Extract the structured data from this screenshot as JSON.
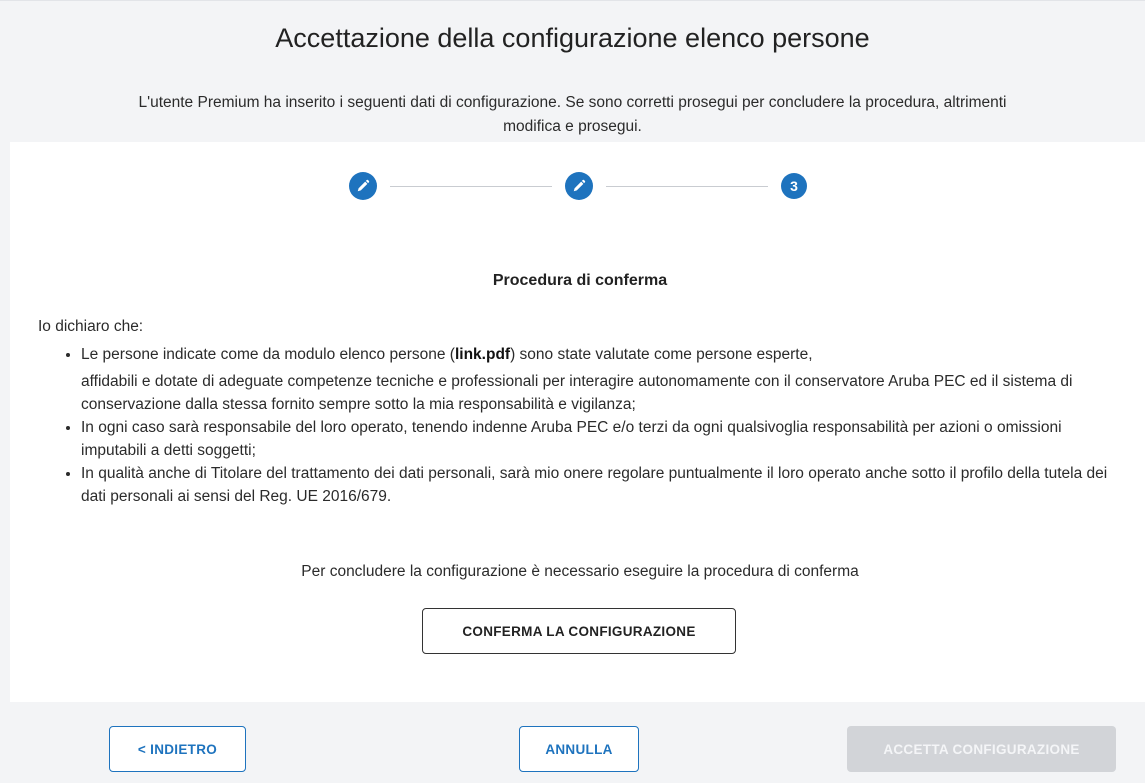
{
  "header": {
    "title": "Accettazione della configurazione elenco persone",
    "subtitle_line1": "L'utente Premium ha inserito i seguenti dati di configurazione. Se sono corretti prosegui per concludere la procedura, altrimenti",
    "subtitle_line2": "modifica e prosegui."
  },
  "stepper": {
    "steps": [
      {
        "state": "completed",
        "icon": "pencil-icon"
      },
      {
        "state": "completed",
        "icon": "pencil-icon"
      },
      {
        "state": "current",
        "label": "3"
      }
    ],
    "accent_color": "#1e73be"
  },
  "content": {
    "section_title": "Procedura di conferma",
    "declaration_intro": "Io dichiaro che:",
    "bullets": [
      {
        "prefix": "Le persone indicate come da modulo elenco persone (",
        "link": "link.pdf",
        "suffix_line1": ") sono state valutate come persone esperte,",
        "rest": "affidabili e dotate di adeguate competenze tecniche e professionali per interagire autonomamente con il conservatore Aruba PEC ed il sistema di conservazione dalla stessa fornito sempre sotto la mia responsabilità e vigilanza;"
      },
      {
        "text": "In ogni caso sarà responsabile del loro operato, tenendo indenne Aruba PEC e/o terzi da ogni qualsivoglia responsabilità per azioni o omissioni imputabili a detti soggetti;"
      },
      {
        "text": "In qualità anche di Titolare del trattamento dei dati personali, sarà mio onere regolare puntualmente il loro operato anche sotto il profilo della tutela dei dati personali ai sensi del Reg. UE 2016/679."
      }
    ],
    "note": "Per concludere la configurazione è necessario eseguire la procedura di conferma",
    "confirm_button": "CONFERMA LA CONFIGURAZIONE"
  },
  "footer": {
    "back_button": "< INDIETRO",
    "cancel_button": "ANNULLA",
    "accept_button": "ACCETTA CONFIGURAZIONE",
    "accept_disabled": true
  }
}
